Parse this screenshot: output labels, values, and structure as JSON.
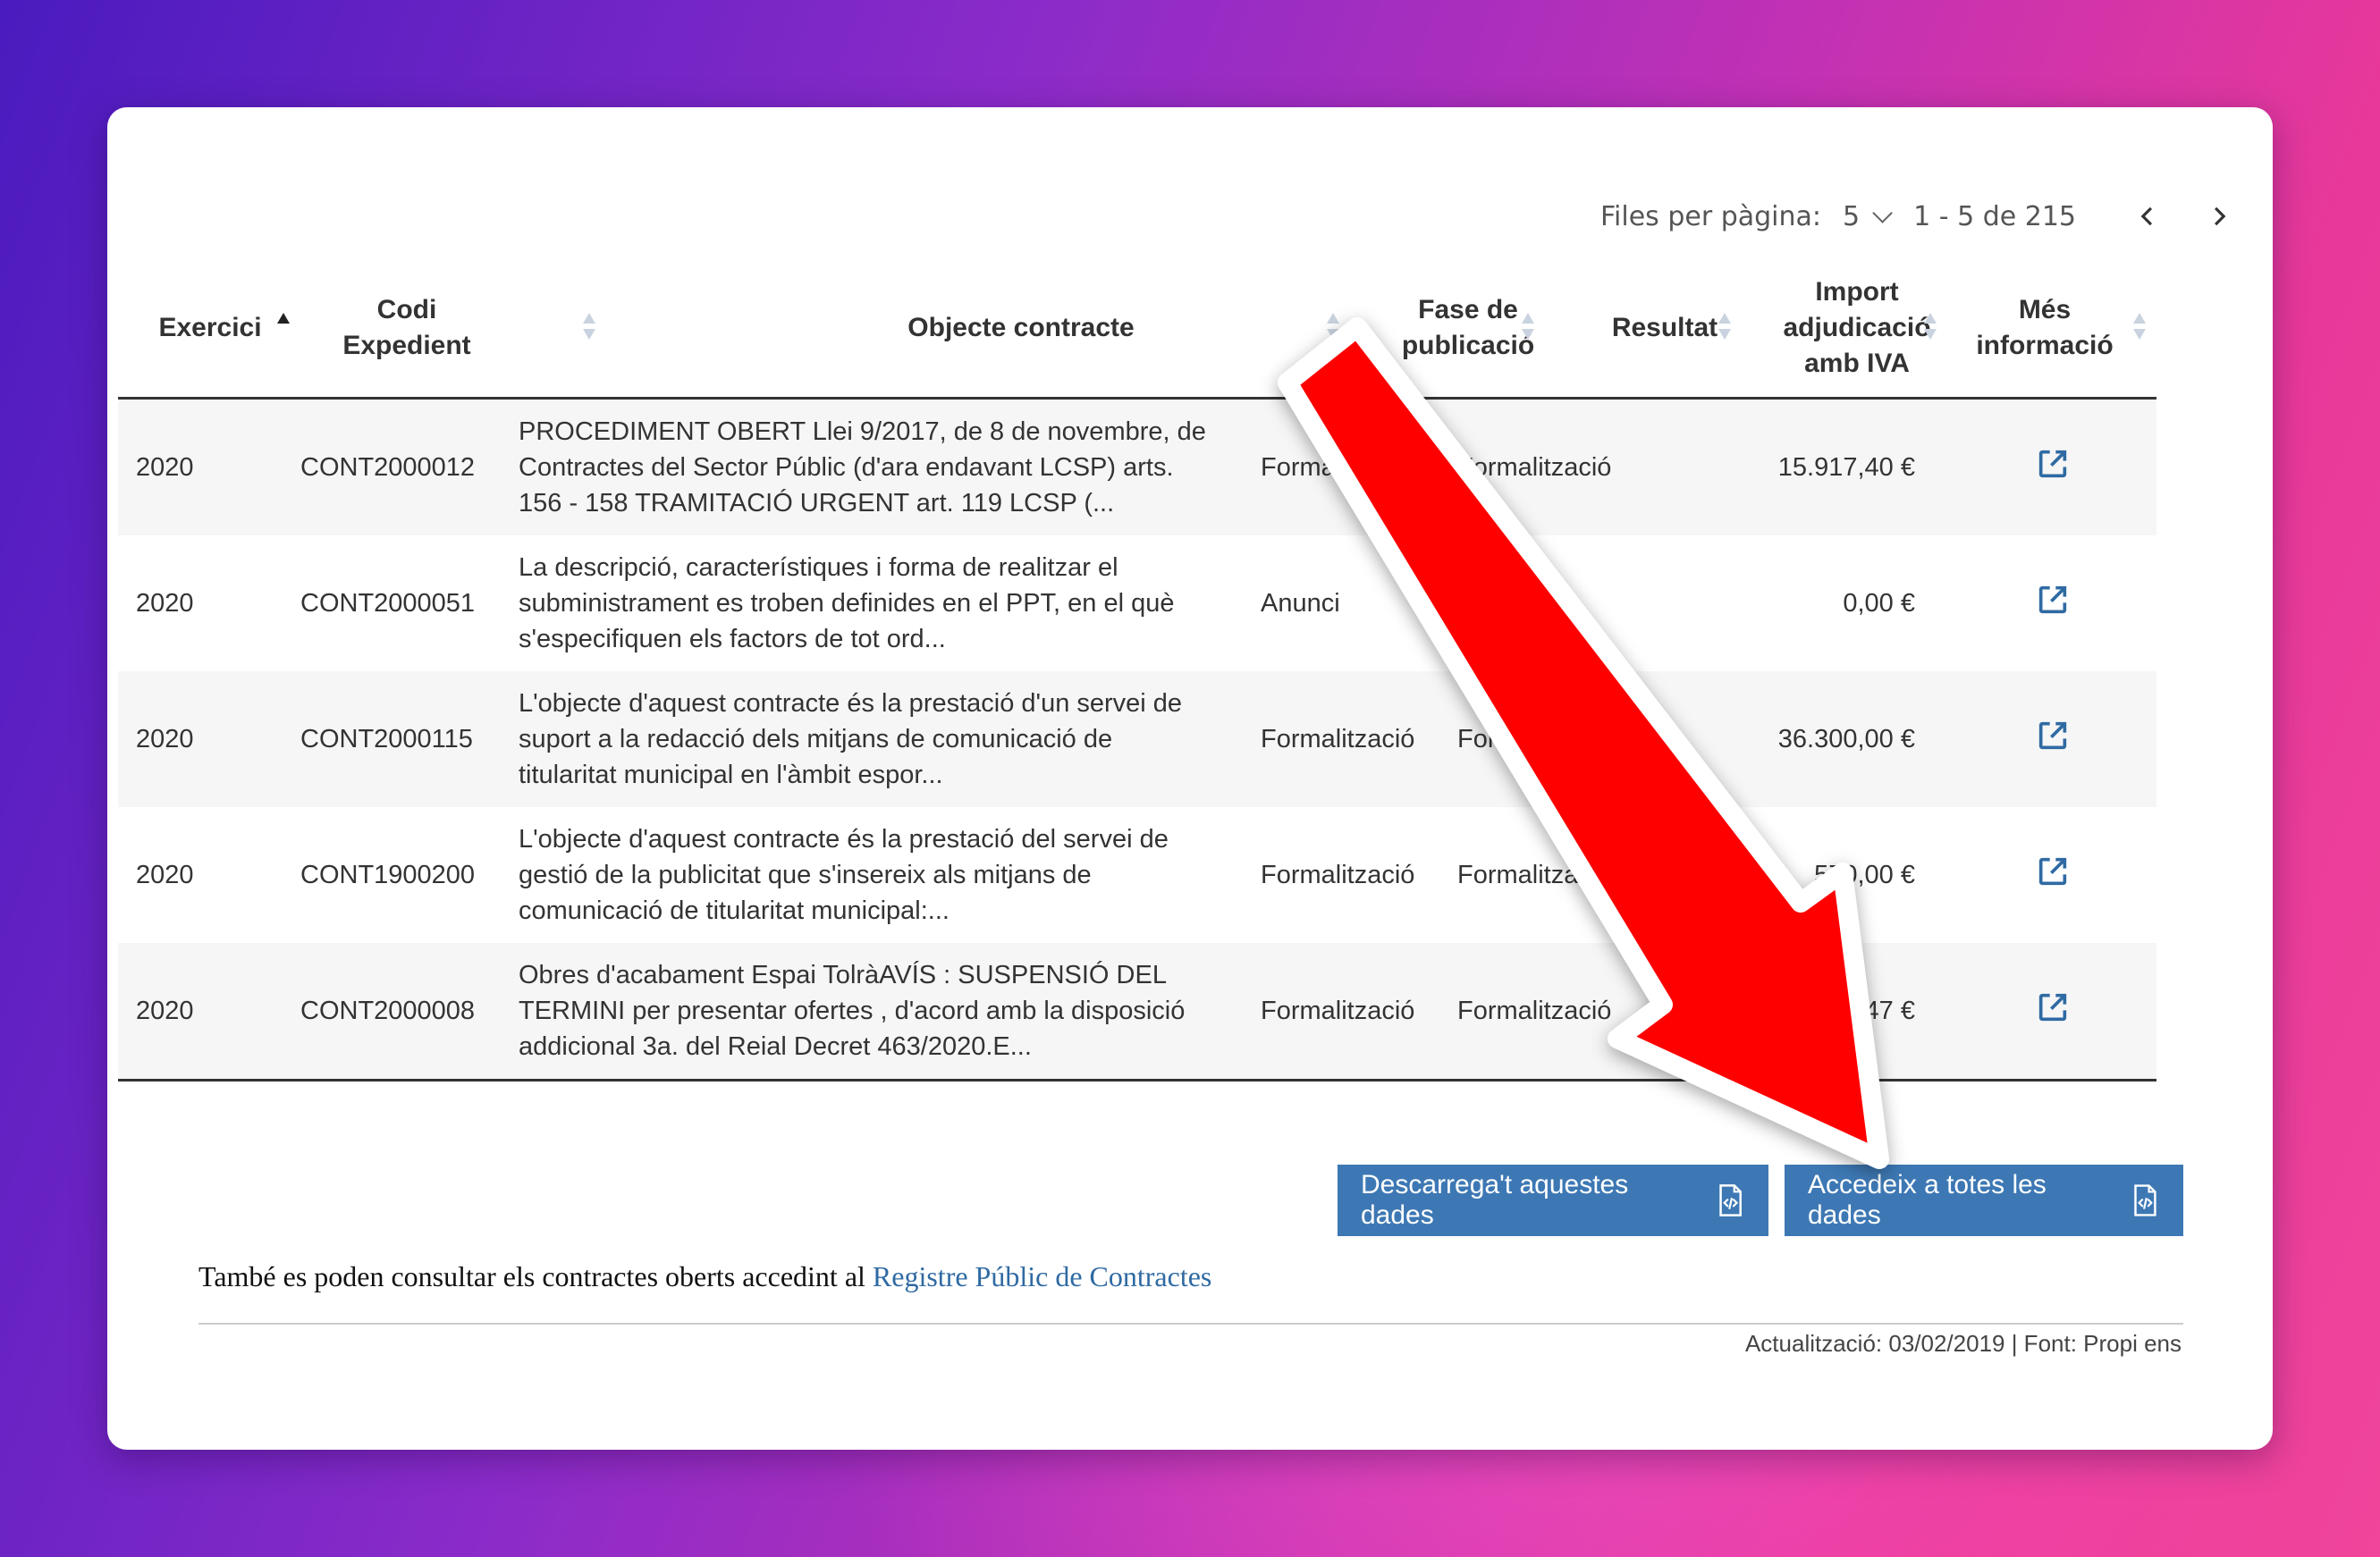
{
  "pager": {
    "label": "Files per pàgina:",
    "per_page": "5",
    "range": "1 - 5 de 215"
  },
  "table": {
    "headers": {
      "exercici": "Exercici",
      "codi": "Codi Expedient",
      "objecte": "Objecte contracte",
      "fase": "Fase de publicació",
      "resultat": "Resultat",
      "import": "Import adjudicació amb IVA",
      "mes": "Més informació"
    },
    "rows": [
      {
        "exercici": "2020",
        "codi": "CONT2000012",
        "objecte": "PROCEDIMENT OBERT Llei 9/2017, de 8 de novembre, de Contractes del Sector Públic (d'ara endavant LCSP) arts. 156 - 158 TRAMITACIÓ URGENT art. 119 LCSP (...",
        "fase": "Formalització",
        "resultat": "Formalització",
        "import": "15.917,40 €"
      },
      {
        "exercici": "2020",
        "codi": "CONT2000051",
        "objecte": "La descripció, característiques i forma de realitzar el subministrament es troben definides en el PPT, en el què s'especifiquen els factors de tot ord...",
        "fase": "Anunci",
        "resultat": "Desert",
        "import": "0,00 €"
      },
      {
        "exercici": "2020",
        "codi": "CONT2000115",
        "objecte": "L'objecte d'aquest contracte és la prestació d'un servei de suport a la redacció dels mitjans de comunicació de titularitat municipal en l'àmbit espor...",
        "fase": "Formalització",
        "resultat": "Formalització",
        "import": "36.300,00 €"
      },
      {
        "exercici": "2020",
        "codi": "CONT1900200",
        "objecte": "L'objecte d'aquest contracte és la prestació del servei de gestió de la publicitat que s'insereix als mitjans de comunicació de titularitat municipal:...",
        "fase": "Formalització",
        "resultat": "Formalització",
        "import": "570,00 €"
      },
      {
        "exercici": "2020",
        "codi": "CONT2000008",
        "objecte": "Obres d'acabament Espai TolràAVÍS : SUSPENSIÓ DEL TERMINI per presentar ofertes , d'acord amb la disposició addicional 3a. del Reial Decret 463/2020.E...",
        "fase": "Formalització",
        "resultat": "Formalització",
        "import": "...,47 €"
      }
    ]
  },
  "buttons": {
    "download": "Descarrega't aquestes dades",
    "all": "Accedeix a totes les dades"
  },
  "note": {
    "text": "També es poden consultar els contractes oberts accedint al ",
    "link": "Registre Públic de Contractes"
  },
  "footer": "Actualització: 03/02/2019 | Font: Propi ens",
  "colors": {
    "accent": "#3d78b4",
    "arrow": "#ff0000"
  }
}
